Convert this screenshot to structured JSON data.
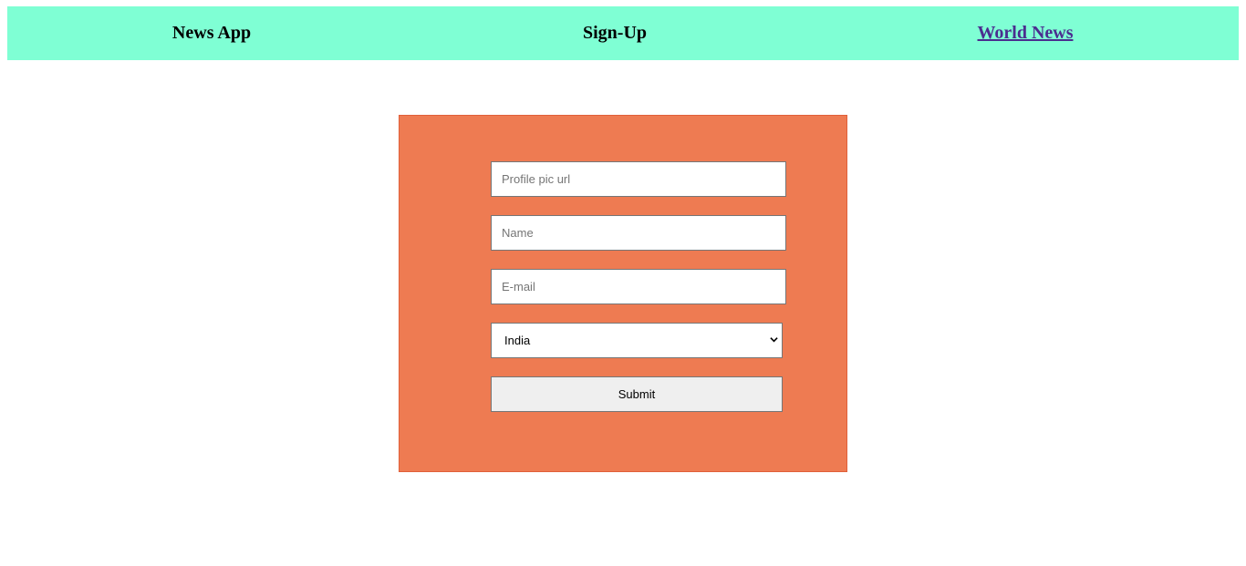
{
  "navbar": {
    "app_title": "News App",
    "page_title": "Sign-Up",
    "world_news_link": "World News"
  },
  "form": {
    "profile_pic_placeholder": "Profile pic url",
    "name_placeholder": "Name",
    "email_placeholder": "E-mail",
    "country_selected": "India",
    "submit_label": "Submit"
  },
  "colors": {
    "navbar_bg": "#7fffd4",
    "form_bg": "#ee7b52",
    "link": "#4b2d8f"
  }
}
